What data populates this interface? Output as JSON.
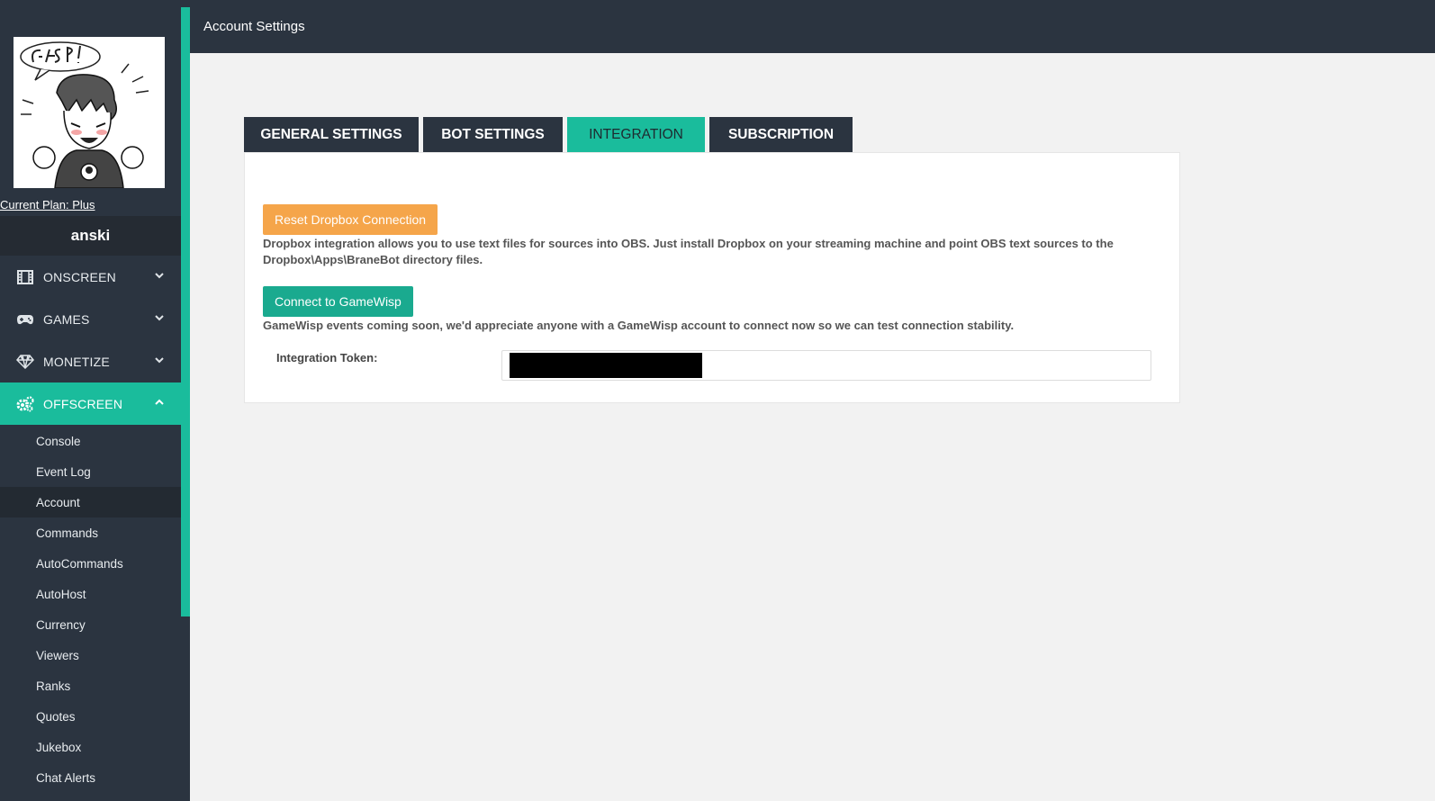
{
  "topbar": {
    "title": "Account Settings"
  },
  "sidebar": {
    "plan_link": "Current Plan: Plus",
    "username": "anski",
    "nav": [
      {
        "label": "ONSCREEN",
        "icon": "film-icon"
      },
      {
        "label": "GAMES",
        "icon": "gamepad-icon"
      },
      {
        "label": "MONETIZE",
        "icon": "diamond-icon"
      },
      {
        "label": "OFFSCREEN",
        "icon": "cogs-icon",
        "active": true
      }
    ],
    "sub_items": [
      "Console",
      "Event Log",
      "Account",
      "Commands",
      "AutoCommands",
      "AutoHost",
      "Currency",
      "Viewers",
      "Ranks",
      "Quotes",
      "Jukebox",
      "Chat Alerts"
    ],
    "current_sub": "Account"
  },
  "tabs": [
    {
      "label": "GENERAL SETTINGS"
    },
    {
      "label": "BOT SETTINGS"
    },
    {
      "label": "INTEGRATION",
      "active": true
    },
    {
      "label": "SUBSCRIPTION"
    }
  ],
  "integration": {
    "dropbox_button": "Reset Dropbox Connection",
    "dropbox_help": "Dropbox integration allows you to use text files for sources into OBS. Just install Dropbox on your streaming machine and point OBS text sources to the Dropbox\\Apps\\BraneBot directory files.",
    "gamewisp_button": "Connect to GameWisp",
    "gamewisp_help": "GameWisp events coming soon, we'd appreciate anyone with a GameWisp account to connect now so we can test connection stability.",
    "token_label": "Integration Token:",
    "token_value": ""
  },
  "colors": {
    "accent": "#1abc9c",
    "sidebar_bg": "#2b3440",
    "orange_button": "#f5a54a",
    "teal_button": "#1aaa8f"
  }
}
